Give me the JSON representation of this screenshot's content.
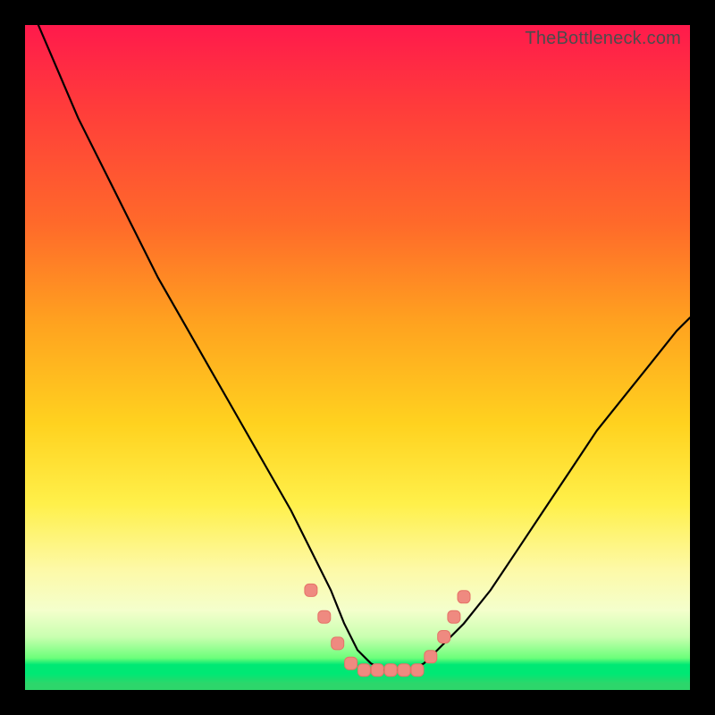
{
  "watermark": "TheBottleneck.com",
  "colors": {
    "frame": "#000000",
    "curve": "#000000",
    "marker_fill": "#ef8a80",
    "marker_stroke": "#e57368"
  },
  "chart_data": {
    "type": "line",
    "title": "",
    "xlabel": "",
    "ylabel": "",
    "xlim": [
      0,
      100
    ],
    "ylim": [
      0,
      100
    ],
    "grid": false,
    "legend": false,
    "note": "Axes are unlabeled; values are estimated from pixel positions. y=0 is the bottom of the colored area (best/green), y=100 is the top (worst/red).",
    "series": [
      {
        "name": "bottleneck-curve",
        "x": [
          2,
          5,
          8,
          12,
          16,
          20,
          24,
          28,
          32,
          36,
          40,
          43,
          46,
          48,
          50,
          52,
          54,
          56,
          58,
          60,
          62,
          66,
          70,
          74,
          78,
          82,
          86,
          90,
          94,
          98,
          100
        ],
        "y": [
          100,
          93,
          86,
          78,
          70,
          62,
          55,
          48,
          41,
          34,
          27,
          21,
          15,
          10,
          6,
          4,
          3,
          3,
          3,
          4,
          6,
          10,
          15,
          21,
          27,
          33,
          39,
          44,
          49,
          54,
          56
        ]
      }
    ],
    "markers": {
      "name": "highlighted-points",
      "shape": "rounded-square",
      "points": [
        {
          "x": 43,
          "y": 15
        },
        {
          "x": 45,
          "y": 11
        },
        {
          "x": 47,
          "y": 7
        },
        {
          "x": 49,
          "y": 4
        },
        {
          "x": 51,
          "y": 3
        },
        {
          "x": 53,
          "y": 3
        },
        {
          "x": 55,
          "y": 3
        },
        {
          "x": 57,
          "y": 3
        },
        {
          "x": 59,
          "y": 3
        },
        {
          "x": 61,
          "y": 5
        },
        {
          "x": 63,
          "y": 8
        },
        {
          "x": 64.5,
          "y": 11
        },
        {
          "x": 66,
          "y": 14
        }
      ]
    },
    "background_gradient": {
      "direction": "vertical",
      "stops": [
        {
          "pos": 0.0,
          "color": "#ff1a4c"
        },
        {
          "pos": 0.3,
          "color": "#ff6a2a"
        },
        {
          "pos": 0.6,
          "color": "#ffd21f"
        },
        {
          "pos": 0.82,
          "color": "#fdf9a8"
        },
        {
          "pos": 0.92,
          "color": "#c9ffb0"
        },
        {
          "pos": 0.96,
          "color": "#00e874"
        },
        {
          "pos": 1.0,
          "color": "#2dd66b"
        }
      ]
    }
  }
}
